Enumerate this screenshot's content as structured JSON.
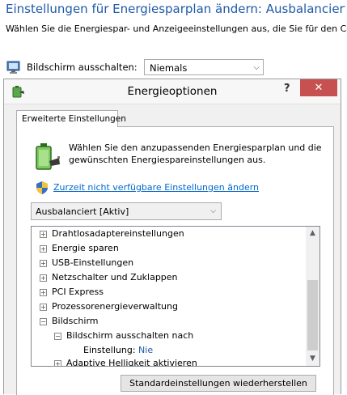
{
  "background": {
    "title": "Einstellungen für Energiesparplan ändern: Ausbalanciert",
    "description": "Wählen Sie die Energiespar- und Anzeigeeinstellungen aus, die Sie für den Comp",
    "display_off_label": "Bildschirm ausschalten:",
    "display_off_value": "Niemals"
  },
  "dialog": {
    "title": "Energieoptionen",
    "help_label": "?",
    "close_label": "✕",
    "tab_label": "Erweiterte Einstellungen",
    "description": "Wählen Sie den anzupassenden Energiesparplan und die gewünschten Energiespareinstellungen aus.",
    "link_label": "Zurzeit nicht verfügbare Einstellungen ändern",
    "plan_select_value": "Ausbalanciert [Aktiv]",
    "tree": [
      {
        "label": "Drahtlosadaptereinstellungen",
        "level": 0,
        "expander": "+"
      },
      {
        "label": "Energie sparen",
        "level": 0,
        "expander": "+"
      },
      {
        "label": "USB-Einstellungen",
        "level": 0,
        "expander": "+"
      },
      {
        "label": "Netzschalter und Zuklappen",
        "level": 0,
        "expander": "+"
      },
      {
        "label": "PCI Express",
        "level": 0,
        "expander": "+"
      },
      {
        "label": "Prozessorenergieverwaltung",
        "level": 0,
        "expander": "+"
      },
      {
        "label": "Bildschirm",
        "level": 0,
        "expander": "−"
      },
      {
        "label": "Bildschirm ausschalten nach",
        "level": 1,
        "expander": "−"
      },
      {
        "label": "Einstellung:",
        "value": "Nie",
        "level": 2
      },
      {
        "label": "Adaptive Helligkeit aktivieren",
        "level": 1,
        "expander": "+"
      }
    ],
    "restore_button": "Standardeinstellungen wiederherstellen"
  },
  "colors": {
    "title_blue": "#1e5aa8",
    "link_blue": "#0066cc",
    "close_red": "#c75050"
  },
  "icons": [
    "power-plan-icon",
    "battery-plug-icon",
    "uac-shield-icon",
    "chevron-down-icon"
  ]
}
